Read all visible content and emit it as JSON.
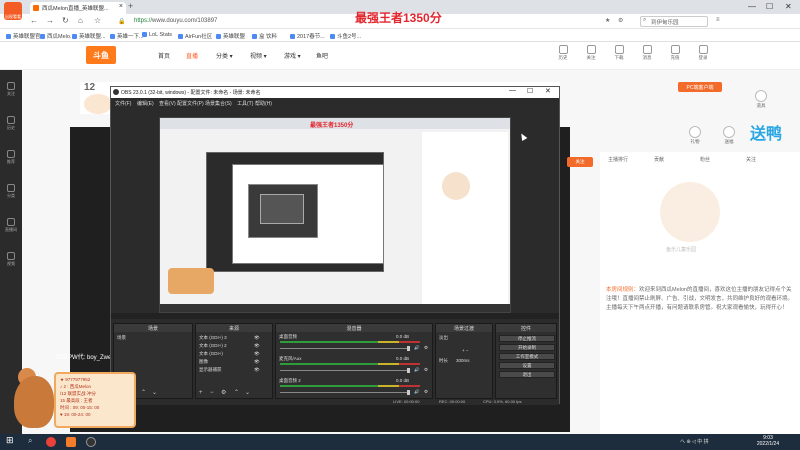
{
  "browser": {
    "app_icon_label": "出现看看",
    "tab_title": "西瓜Melon直播_英雄联盟...",
    "tab_close": "×",
    "new_tab": "+",
    "url_secure": "https://",
    "url_rest": "www.douyu.com/103897",
    "search_placeholder": "到伊甸乐园",
    "bookmarks": [
      "英雄联盟官...",
      "西瓜Melo...",
      "英雄联盟...",
      "英雄一下...",
      "LoL Stats",
      "AirFun社区",
      "英雄联盟",
      "盒 饮料",
      "2017春节...",
      "斗鱼2号..."
    ],
    "window_controls": {
      "minimize": "—",
      "maximize": "☐",
      "close": "✕"
    }
  },
  "overlay_title": "最强王者1350分",
  "douyu": {
    "logo": "斗鱼",
    "nav": [
      {
        "label": "首页",
        "active": false
      },
      {
        "label": "直播",
        "active": true
      },
      {
        "label": "分类 ▾",
        "active": false
      },
      {
        "label": "视频 ▾",
        "active": false
      },
      {
        "label": "游戏 ▾",
        "active": false
      },
      {
        "label": "鱼吧",
        "active": false
      }
    ],
    "header_icons": [
      "历史",
      "关注",
      "下载",
      "消息",
      "充值",
      "登录"
    ],
    "left_icons": [
      "关注",
      "历史",
      "推荐",
      "分类",
      "直播间",
      "视频"
    ],
    "room_number": "12",
    "pc_button": "PC端客户端",
    "right_icons": [
      "道具",
      "礼物",
      "送福"
    ],
    "tabs": [
      "主播排行",
      "贡献",
      "粉丝",
      "关注"
    ],
    "mascot_text": "鱼乐儿童乐园",
    "side_big_text": "送鸭",
    "orange_button": "关注",
    "description_highlight": "本房间规则：",
    "description": "欢迎来到西瓜Melon的直播间，喜欢这位主播的朋友记得点个关注哦！直播间禁止刷屏、广告、引战，文明发言，共同维护良好的观看环境。主播每天下午两点开播，有问题请联系房管。祝大家观看愉快，玩得开心！"
  },
  "sticker": {
    "top_text": "西瓜PW代: boy_Zwe",
    "lines": [
      "★ 9777977952",
      "♪ 2 : 西瓜Melon",
      "/12 联盟实战·冲分",
      "15 最高段 : 王者",
      "时间 : 09: 00-15: 00",
      "♥ 19: 00-24: 00"
    ]
  },
  "obs": {
    "title": "OBS 23.0.1 (32-bit, windows) - 配置文件: 未命名 - 场景: 未命名",
    "menus": [
      "文件(F)",
      "编辑(E)",
      "查看(V)",
      "配置文件(P)",
      "场景集合(S)",
      "工具(T)",
      "帮助(H)"
    ],
    "preview_title": "最强王者1350分",
    "docks": {
      "scenes": {
        "header": "场景",
        "items": [
          "场景"
        ]
      },
      "sources": {
        "header": "来源",
        "items": [
          "文本 (GDI+) 3",
          "文本 (GDI+) 2",
          "文本 (GDI+)",
          "图像",
          "显示器捕获"
        ]
      },
      "mixer": {
        "header": "混音器",
        "channels": [
          {
            "name": "桌面音频",
            "level": "0.0 dB"
          },
          {
            "name": "麦克风/Aux",
            "level": "0.0 dB"
          },
          {
            "name": "桌面音频 2",
            "level": "0.0 dB"
          }
        ]
      },
      "transitions": {
        "header": "场景过渡",
        "type": "淡出",
        "duration_label": "时长",
        "duration": "300ms"
      },
      "controls": {
        "header": "控件",
        "buttons": [
          "停止推流",
          "开始录制",
          "工作室模式",
          "设置",
          "退出"
        ]
      }
    },
    "status": {
      "live": "LIVE: 00:00:00",
      "rec": "REC: 00:00:00",
      "cpu": "CPU: 3.9%, 60.00 fps"
    }
  },
  "taskbar": {
    "tray": "へ ⊕ ◁ 中 拼",
    "time": "9:03",
    "date": "2022/1/24"
  }
}
